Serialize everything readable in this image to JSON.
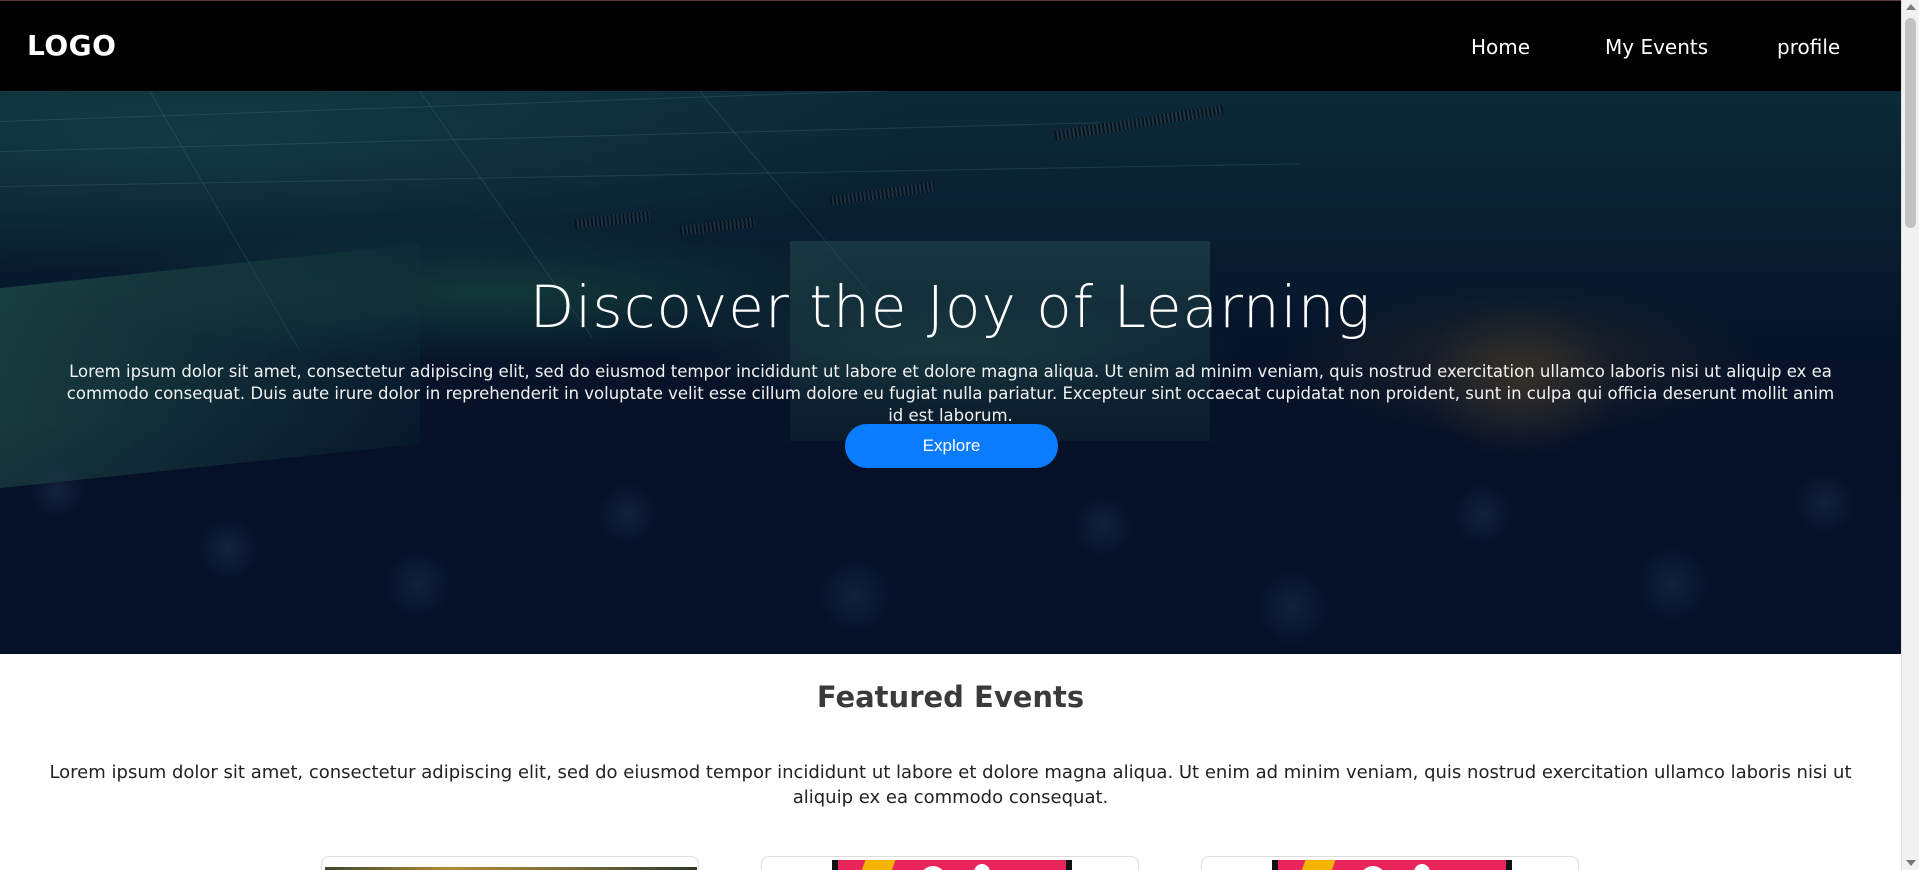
{
  "nav": {
    "logo": "LOGO",
    "links": [
      {
        "label": "Home"
      },
      {
        "label": "My Events"
      },
      {
        "label": "profile"
      }
    ]
  },
  "hero": {
    "title": "Discover the Joy of Learning",
    "text": "Lorem ipsum dolor sit amet, consectetur adipiscing elit, sed do eiusmod tempor incididunt ut labore et dolore magna aliqua. Ut enim ad minim veniam, quis nostrud exercitation ullamco laboris nisi ut aliquip ex ea commodo consequat. Duis aute irure dolor in reprehenderit in voluptate velit esse cillum dolore eu fugiat nulla pariatur. Excepteur sint occaecat cupidatat non proident, sunt in culpa qui officia deserunt mollit anim id est laborum.",
    "button_label": "Explore"
  },
  "featured": {
    "title": "Featured Events",
    "text": "Lorem ipsum dolor sit amet, consectetur adipiscing elit, sed do eiusmod tempor incididunt ut labore et dolore magna aliqua. Ut enim ad minim veniam, quis nostrud exercitation ullamco laboris nisi ut aliquip ex ea commodo consequat."
  },
  "colors": {
    "nav_bg": "#000000",
    "accent": "#0a7cff",
    "event_pink": "#e8245a",
    "event_yellow": "#f5b400"
  }
}
